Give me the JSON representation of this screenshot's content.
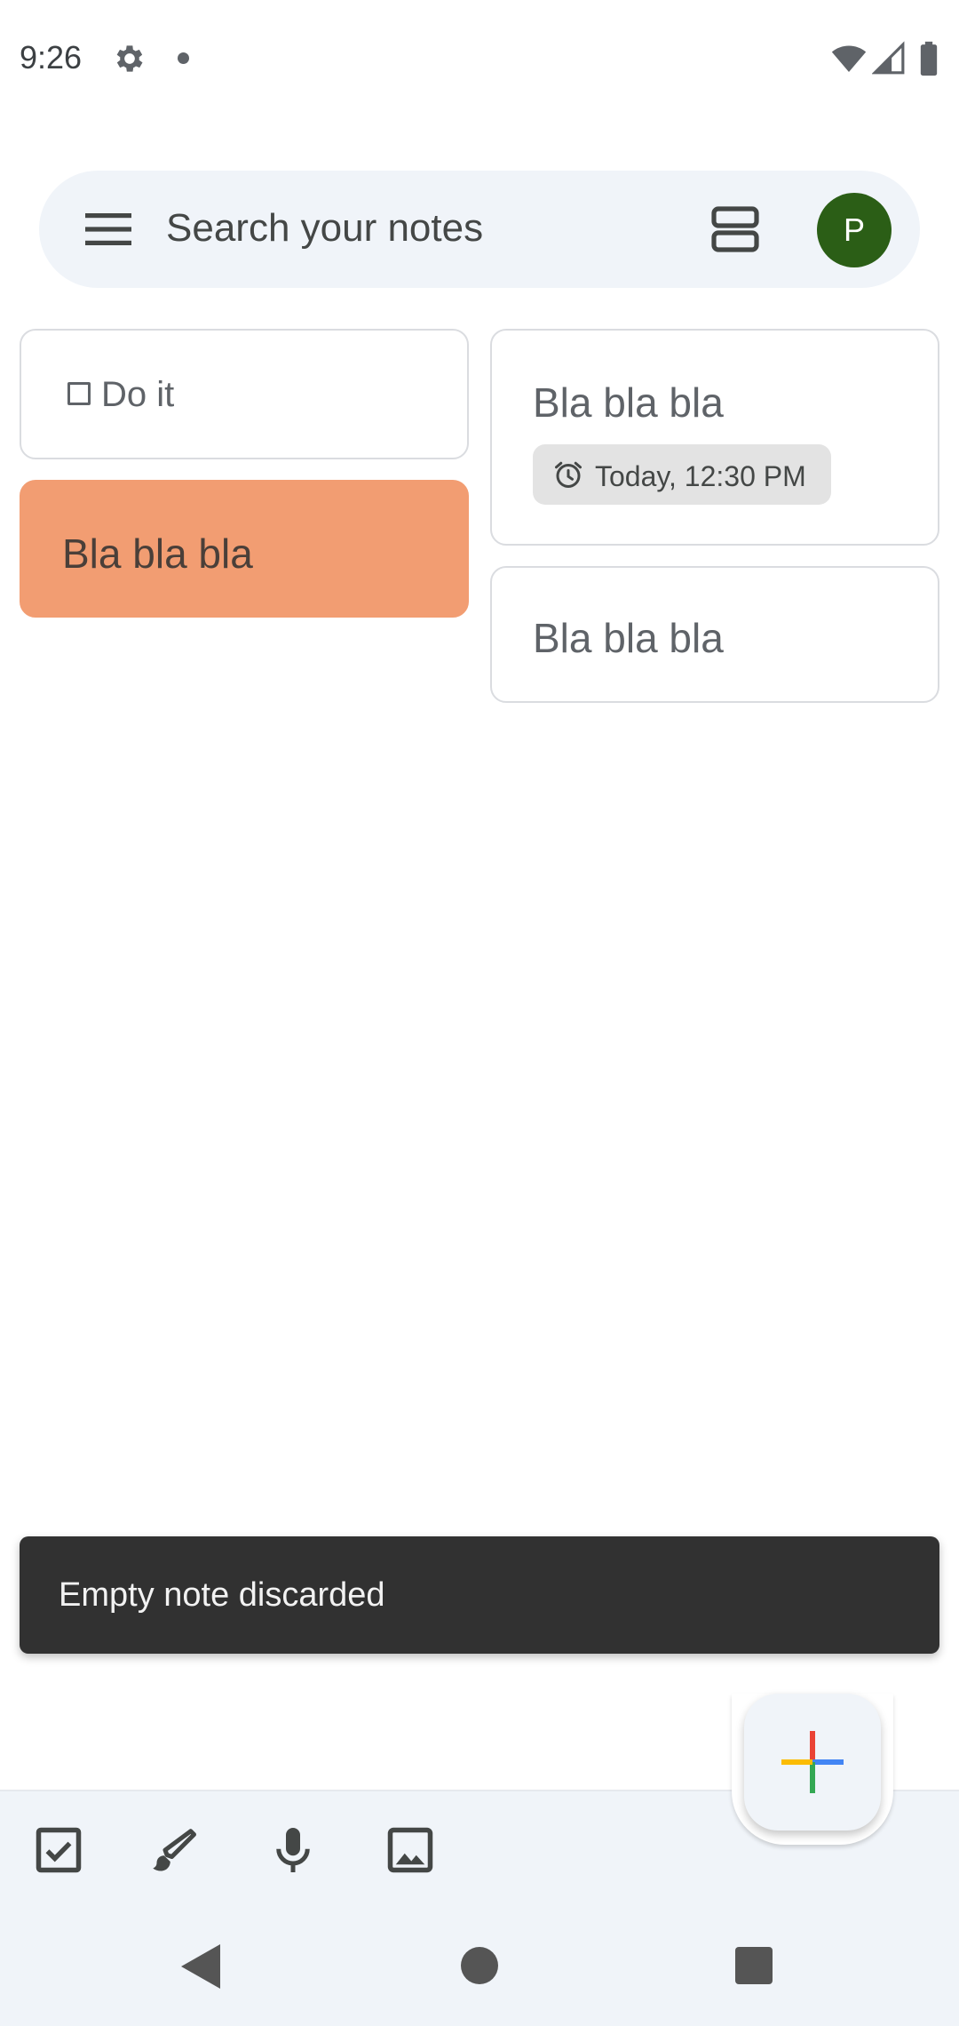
{
  "status_bar": {
    "time": "9:26",
    "icons": [
      "gear-icon",
      "notification-dot-icon",
      "wifi-icon",
      "signal-icon",
      "battery-icon"
    ]
  },
  "search": {
    "placeholder": "Search your notes",
    "avatar_initial": "P",
    "avatar_color": "#2b5e16"
  },
  "notes": [
    {
      "type": "checklist",
      "item": "Do it",
      "checked": false
    },
    {
      "type": "text",
      "title": "Bla bla bla",
      "color": "#f29d72"
    },
    {
      "type": "text",
      "title": "Bla bla bla",
      "reminder": "Today, 12:30 PM"
    },
    {
      "type": "text",
      "title": "Bla bla bla"
    }
  ],
  "snackbar": {
    "message": "Empty note discarded"
  },
  "bottom_bar": {
    "actions": [
      "new-list-icon",
      "drawing-icon",
      "audio-icon",
      "image-icon"
    ],
    "fab": "new-note-plus-icon"
  },
  "nav_bar": {
    "buttons": [
      "back",
      "home",
      "recents"
    ]
  },
  "colors": {
    "search_bg": "#f0f4f9",
    "note_border": "#dadce0",
    "snackbar_bg": "#313131",
    "plus_red": "#ea4335",
    "plus_blue": "#4285f4",
    "plus_green": "#34a853",
    "plus_yellow": "#fbbc04"
  }
}
